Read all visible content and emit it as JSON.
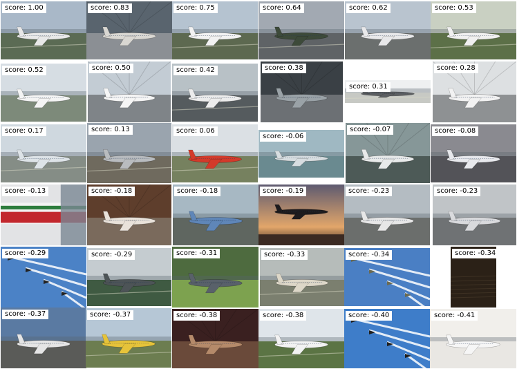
{
  "score_prefix": "score: ",
  "tiles": [
    {
      "score": "1.00",
      "scene": "runway",
      "bg": "#8ea1b6",
      "ground": "#5b6b54",
      "sky": "#a9b8c8",
      "plane": "#e8e8e8"
    },
    {
      "score": "0.83",
      "scene": "hangar",
      "bg": "#6c7a86",
      "ground": "#8b8f94",
      "sky": "#59646e",
      "plane": "#d9d7d2"
    },
    {
      "score": "0.75",
      "scene": "runway",
      "bg": "#8da2b4",
      "ground": "#5d6950",
      "sky": "#b5c3d0",
      "plane": "#f2f2f2"
    },
    {
      "score": "0.64",
      "scene": "runway",
      "bg": "#7f8893",
      "ground": "#5f6366",
      "sky": "#a2a9b2",
      "plane": "#3d4a3a"
    },
    {
      "score": "0.62",
      "scene": "apron",
      "bg": "#9aa7b5",
      "ground": "#6b6f6e",
      "sky": "#b9c4cf",
      "plane": "#e8e8ea"
    },
    {
      "score": "0.53",
      "scene": "runway",
      "bg": "#a8b2a1",
      "ground": "#5c7048",
      "sky": "#c9d0c2",
      "plane": "#f0f0f0"
    },
    {
      "score": "0.52",
      "scene": "apron",
      "bg": "#c4ccd4",
      "ground": "#7d8a7a",
      "sky": "#d6dde3",
      "plane": "#f4f4f4"
    },
    {
      "score": "0.50",
      "scene": "gate",
      "bg": "#aab5bf",
      "ground": "#7f8488",
      "sky": "#c3ccd4",
      "plane": "#f5f5f5"
    },
    {
      "score": "0.42",
      "scene": "runway",
      "bg": "#99a4ab",
      "ground": "#555b5e",
      "sky": "#b8c1c6",
      "plane": "#ececec"
    },
    {
      "score": "0.38",
      "scene": "hangar",
      "bg": "#4b5257",
      "ground": "#6c7074",
      "sky": "#3a4045",
      "plane": "#9aa2a7"
    },
    {
      "score": "0.31",
      "scene": "runway",
      "bg": "#e3e6e8",
      "ground": "#c7c9c4",
      "sky": "#eef0f1",
      "plane": "#5d6063"
    },
    {
      "score": "0.28",
      "scene": "hangar",
      "bg": "#cfd3d6",
      "ground": "#8e9193",
      "sky": "#dde0e2",
      "plane": "#f2f2f2"
    },
    {
      "score": "0.17",
      "scene": "runway",
      "bg": "#b8c6d1",
      "ground": "#858d86",
      "sky": "#cfd8df",
      "plane": "#dde3e7"
    },
    {
      "score": "0.13",
      "scene": "runway",
      "bg": "#7c8794",
      "ground": "#6f6a5e",
      "sky": "#9aa4ae",
      "plane": "#b9bcbf"
    },
    {
      "score": "0.06",
      "scene": "runway",
      "bg": "#c9cfd4",
      "ground": "#76815f",
      "sky": "#dbe0e4",
      "plane": "#d33a2a"
    },
    {
      "score": "-0.06",
      "scene": "apron",
      "bg": "#88a5b2",
      "ground": "#6a8a90",
      "sky": "#9fb8c2",
      "plane": "#d7dde0"
    },
    {
      "score": "-0.07",
      "scene": "gate",
      "bg": "#6b7d7e",
      "ground": "#4d5a57",
      "sky": "#869798",
      "plane": "#e8eaea"
    },
    {
      "score": "-0.08",
      "scene": "sky",
      "bg": "#6e6f75",
      "ground": "#535358",
      "sky": "#8a8a90",
      "plane": "#e7e8ec"
    },
    {
      "score": "-0.13",
      "scene": "closeup",
      "bg": "#c9cacc",
      "ground": "#c2272d",
      "sky": "#e2e3e5",
      "plane": "#f1f1f1"
    },
    {
      "score": "-0.18",
      "scene": "hangar",
      "bg": "#8a5b3c",
      "ground": "#7a6a5c",
      "sky": "#5e3e2c",
      "plane": "#e9e2da"
    },
    {
      "score": "-0.18",
      "scene": "apron",
      "bg": "#8ca0ad",
      "ground": "#5f6660",
      "sky": "#a7b8c3",
      "plane": "#5f86b8"
    },
    {
      "score": "-0.19",
      "scene": "sunset",
      "bg": "#c58a52",
      "ground": "#3b2a22",
      "sky": "#e2a66a",
      "plane": "#1d1b1e"
    },
    {
      "score": "-0.23",
      "scene": "apron",
      "bg": "#9aa3aa",
      "ground": "#6b6e6c",
      "sky": "#b4bcc2",
      "plane": "#e7e7e7"
    },
    {
      "score": "-0.23",
      "scene": "apron",
      "bg": "#a4a9ad",
      "ground": "#6f7274",
      "sky": "#c0c4c7",
      "plane": "#d9dadd"
    },
    {
      "score": "-0.29",
      "scene": "formation",
      "bg": "#3c6fb4",
      "ground": "#3c6fb4",
      "sky": "#4b82c6",
      "plane": "#222222"
    },
    {
      "score": "-0.29",
      "scene": "runway",
      "bg": "#a9b3b8",
      "ground": "#3f5a42",
      "sky": "#c5ccd0",
      "plane": "#4d5457"
    },
    {
      "score": "-0.31",
      "scene": "field",
      "bg": "#6a8c5a",
      "ground": "#7da24f",
      "sky": "#4e6b3f",
      "plane": "#59616a"
    },
    {
      "score": "-0.33",
      "scene": "runway",
      "bg": "#9aa3a0",
      "ground": "#7b7f6f",
      "sky": "#b6bcba",
      "plane": "#ddd7c8"
    },
    {
      "score": "-0.34",
      "scene": "formation",
      "bg": "#3a6db3",
      "ground": "#3a6db3",
      "sky": "#4a7fc4",
      "plane": "#6a6a52"
    },
    {
      "score": "-0.34",
      "scene": "dark",
      "bg": "#2b2117",
      "ground": "#1a140e",
      "sky": "#3d2f20",
      "plane": "#1a140e"
    },
    {
      "score": "-0.37",
      "scene": "apron",
      "bg": "#3e5f8a",
      "ground": "#5a5b58",
      "sky": "#5a7aa2",
      "plane": "#e5e5e5"
    },
    {
      "score": "-0.37",
      "scene": "runway",
      "bg": "#9ab0c6",
      "ground": "#6c7d50",
      "sky": "#b6c7d6",
      "plane": "#e6c33a"
    },
    {
      "score": "-0.38",
      "scene": "hangar",
      "bg": "#4a2c2c",
      "ground": "#6a4a3a",
      "sky": "#3a2020",
      "plane": "#b58a6a"
    },
    {
      "score": "-0.38",
      "scene": "runway",
      "bg": "#c8d2da",
      "ground": "#5b7444",
      "sky": "#dfe5ea",
      "plane": "#f2f2f2"
    },
    {
      "score": "-0.40",
      "scene": "formation",
      "bg": "#2f6bb7",
      "ground": "#2f6bb7",
      "sky": "#3e7dc9",
      "plane": "#1f1f1f"
    },
    {
      "score": "-0.41",
      "scene": "sky",
      "bg": "#e9e7e3",
      "ground": "#e9e7e3",
      "sky": "#f1efeb",
      "plane": "#f6f6f6"
    }
  ]
}
